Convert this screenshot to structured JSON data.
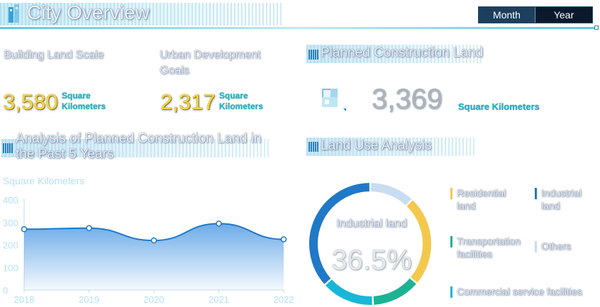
{
  "header": {
    "title": "City Overview",
    "toggle": [
      "Month",
      "Year"
    ]
  },
  "kpis": [
    {
      "label": "Building Land Scale",
      "value": "3,580",
      "unit_line1": "Square",
      "unit_line2": "Kilometers"
    },
    {
      "label_line1": "Urban Development",
      "label_line2": "Goals",
      "value": "2,317",
      "unit_line1": "Square",
      "unit_line2": "Kilometers"
    }
  ],
  "planned": {
    "title": "Planned Construction Land",
    "value": "3,369",
    "unit": "Square Kilometers"
  },
  "analysis": {
    "title_line1": "Analysis of Planned Construction Land in",
    "title_line2": "the Past 5 Years",
    "unit": "Square Kilometers"
  },
  "land_use": {
    "title": "Land Use Analysis",
    "center_label": "Industrial land",
    "center_value": "36.5%",
    "legend": [
      {
        "line1": "Residential",
        "line2": "land",
        "color": "#f2c94c"
      },
      {
        "line1": "Industrial",
        "line2": "land",
        "color": "#1f78c8"
      },
      {
        "line1": "Transportation",
        "line2": "facilities",
        "color": "#1bb394"
      },
      {
        "line1": "Others",
        "line2": "",
        "color": "#c8dcf2"
      },
      {
        "line1": "Commercial service facilities",
        "line2": "",
        "color": "#18b7d8"
      }
    ]
  },
  "chart_data": {
    "type": "area",
    "x": [
      "2018",
      "2019",
      "2020",
      "2021",
      "2022"
    ],
    "values": [
      270,
      275,
      220,
      295,
      225
    ],
    "ylim": [
      0,
      400
    ],
    "yticks": [
      0,
      100,
      200,
      300,
      400
    ],
    "ylabel": "Square Kilometers",
    "grid": false,
    "color": "#1f78c8"
  },
  "donut_data": {
    "type": "pie",
    "slices": [
      {
        "label": "Others",
        "value": 0.12,
        "color": "#c8dcf2"
      },
      {
        "label": "Residential land",
        "value": 0.24,
        "color": "#f2c94c"
      },
      {
        "label": "Transportation facilities",
        "value": 0.13,
        "color": "#1bb394"
      },
      {
        "label": "Commercial service facilities",
        "value": 0.14,
        "color": "#18b7d8"
      },
      {
        "label": "Industrial land",
        "value": 0.365,
        "color": "#1f78c8"
      }
    ]
  }
}
